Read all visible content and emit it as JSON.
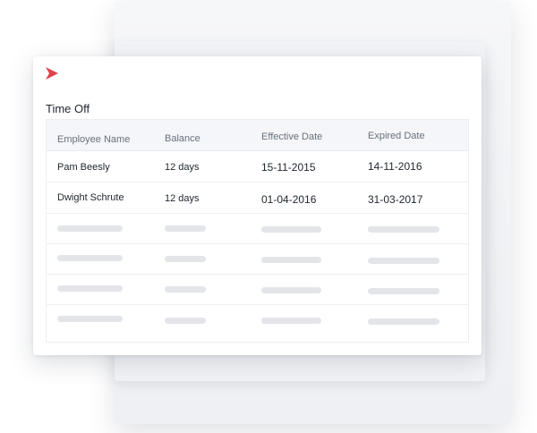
{
  "page": {
    "title": "Time Off"
  },
  "brand": {
    "accent_color": "#e0424b",
    "logo_icon": "chevron-right-icon"
  },
  "table": {
    "headers": {
      "employee_name": "Employee Name",
      "balance": "Balance",
      "effective_date": "Effective Date",
      "expired_date": "Expired Date"
    },
    "rows": [
      {
        "employee_name": "Pam Beesly",
        "balance": "12 days",
        "effective_date": "15-11-2015",
        "expired_date": "14-11-2016"
      },
      {
        "employee_name": "Dwight Schrute",
        "balance": "12 days",
        "effective_date": "01-04-2016",
        "expired_date": "31-03-2017"
      }
    ]
  }
}
